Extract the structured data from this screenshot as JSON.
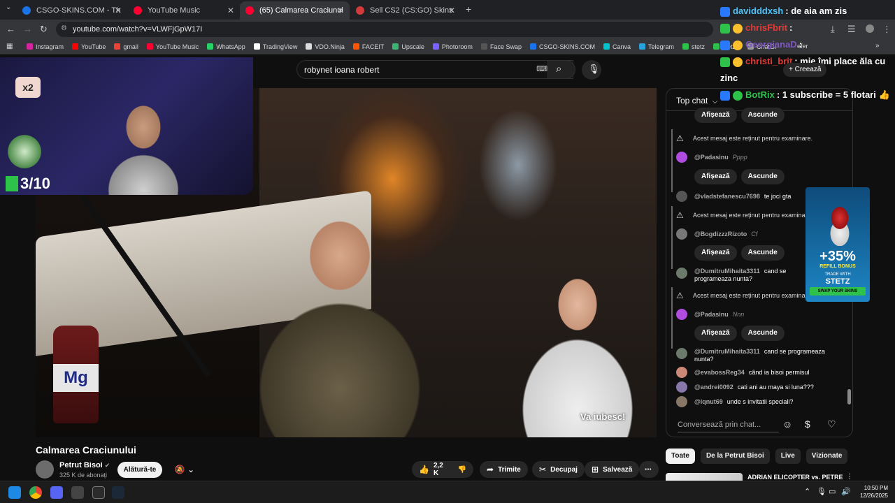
{
  "browser": {
    "tabs": [
      {
        "title": "CSGO-SKINS.COM - The best C",
        "color": "#1a73e8"
      },
      {
        "title": "YouTube Music",
        "color": "#ff0033"
      },
      {
        "title": "(65) Calmarea Craciunului -",
        "color": "#ff0033"
      },
      {
        "title": "Sell CS2 (CS:GO) Skins | Best CS",
        "color": "#d23b3b"
      }
    ],
    "url": "youtube.com/watch?v=VLWFjGpW17I",
    "bookmarks": [
      {
        "label": "Instagram",
        "color": "#d6249f"
      },
      {
        "label": "YouTube",
        "color": "#ff0000"
      },
      {
        "label": "gmail",
        "color": "#ea4335"
      },
      {
        "label": "YouTube Music",
        "color": "#ff0033"
      },
      {
        "label": "WhatsApp",
        "color": "#25d366"
      },
      {
        "label": "TradingView",
        "color": "#ffffff"
      },
      {
        "label": "VDO.Ninja",
        "color": "#dddddd"
      },
      {
        "label": "FACEIT",
        "color": "#ff5500"
      },
      {
        "label": "Upscale",
        "color": "#3cb371"
      },
      {
        "label": "Photoroom",
        "color": "#7b61ff"
      },
      {
        "label": "Face Swap",
        "color": "#555555"
      },
      {
        "label": "CSGO-SKINS.COM",
        "color": "#1a73e8"
      },
      {
        "label": "Canva",
        "color": "#00c4cc"
      },
      {
        "label": "Telegram",
        "color": "#2aa1da"
      },
      {
        "label": "stetz",
        "color": "#2ec24a"
      },
      {
        "label": "stetz2",
        "color": "#2ec24a"
      },
      {
        "label": "ChatGP",
        "color": "#999999"
      }
    ],
    "bookmark_tail": "efer"
  },
  "youtube": {
    "search_query": "robynet ioana robert",
    "create_label": "Creează"
  },
  "video": {
    "x2": "x2",
    "counter": "3/10",
    "subtitle": "Va iubesc!",
    "bottle_label": "Mg"
  },
  "overlay": [
    {
      "user": "davidddxsh",
      "text": ": de aia am zis",
      "user_color": "#4fc3f7",
      "badge": "#2979ff"
    },
    {
      "user": "chrisFbrit",
      "text": ":",
      "user_color": "#e53935",
      "badge": "#2ec24a"
    },
    {
      "user": "GeorgianaD",
      "text": ":",
      "user_color": "#7e57c2",
      "badge": "#2979ff"
    },
    {
      "user": "christi_brit",
      "text": ": mie îmi place ăla cu",
      "user_color": "#e53935",
      "badge": "#2ec24a"
    },
    {
      "user": "",
      "text": "zinc",
      "user_color": "#ffffff",
      "badge": ""
    },
    {
      "user": "BotRix",
      "text": ": 1 subscribe = 5 flotari 👍",
      "user_color": "#2ec24a",
      "badge": "#2979ff"
    }
  ],
  "chat": {
    "header": "Top chat",
    "held_text": "Acest mesaj este reținut pentru examinare.",
    "show_label": "Afișează",
    "hide_label": "Ascunde",
    "messages": [
      {
        "user": "@Padasinu",
        "text": "Pppp",
        "italic": true,
        "color": "#b04ce0"
      },
      {
        "user": "@vladstefanescu7698",
        "text": "te joci gta",
        "italic": false,
        "color": "#555555"
      },
      {
        "user": "@BogdizzzRizoto",
        "text": "Cf",
        "italic": true,
        "color": "#777777"
      },
      {
        "user": "@DumitruMihaita3311",
        "text": "cand se programeaza nunta?",
        "italic": false,
        "color": "#6b7a6b"
      },
      {
        "user": "@Padasinu",
        "text": "Nnn",
        "italic": true,
        "color": "#b04ce0"
      },
      {
        "user": "@DumitruMihaita3311",
        "text": "cand se programeaza nunta?",
        "italic": false,
        "color": "#6b7a6b"
      },
      {
        "user": "@evabossReg34",
        "text": "când ia bisoi permisul",
        "italic": false,
        "color": "#cc8877"
      },
      {
        "user": "@andrei0092",
        "text": "cati ani au maya si luna???",
        "italic": false,
        "color": "#8877aa"
      },
      {
        "user": "@iqnut69",
        "text": "unde s invitatii speciali?",
        "italic": false,
        "color": "#887766"
      }
    ],
    "input_placeholder": "Conversează prin chat..."
  },
  "ad": {
    "pct": "+35%",
    "sub": "REFILL BONUS",
    "trade": "TRADE WITH",
    "brand": "STETZ",
    "cta": "SWAP YOUR SKINS"
  },
  "below": {
    "title": "Calmarea Craciunului",
    "channel": "Petrut Bisoi",
    "subs": "325 K de abonați",
    "join": "Alătură-te",
    "likes": "2,2 K",
    "share": "Trimite",
    "clip": "Decupaj",
    "save": "Salvează",
    "chips": [
      "Toate",
      "De la Petrut Bisoi",
      "Live",
      "Vizionate"
    ],
    "rec_title": "ADRIAN ELICOPTER vs. PETRE"
  },
  "taskbar": {
    "time": "10:50 PM",
    "date": "12/26/2025"
  }
}
